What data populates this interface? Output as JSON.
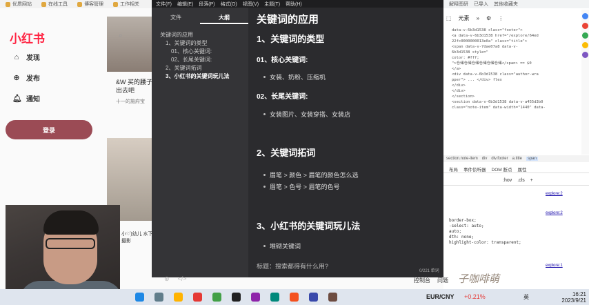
{
  "bookmarks": [
    "优质网站",
    "在线工具",
    "博客管理",
    "工作相关"
  ],
  "xhs": {
    "logo": "小红书",
    "nav": [
      {
        "label": "发现",
        "icon": "home-icon"
      },
      {
        "label": "发布",
        "icon": "plus-icon"
      },
      {
        "label": "通知",
        "icon": "bell-icon"
      }
    ],
    "login_label": "登录",
    "card_title": "&W 买的腰子 出去吧",
    "card_meta": "十一的施府宝",
    "card2": "小♡)幼儿 水下摄影"
  },
  "editor": {
    "menu": [
      "文件(F)",
      "编辑(E)",
      "段落(P)",
      "格式(O)",
      "视图(V)",
      "主题(T)",
      "帮助(H)"
    ],
    "tabs": {
      "file": "文件",
      "outline": "大纲"
    },
    "outline": [
      {
        "text": "关键词的应用",
        "level": 1
      },
      {
        "text": "1、关键词的类型",
        "level": 2
      },
      {
        "text": "01、核心关键词:",
        "level": 3
      },
      {
        "text": "02、长尾关键词:",
        "level": 3
      },
      {
        "text": "2、关键词拓词",
        "level": 2
      },
      {
        "text": "3、小红书的关键词玩儿法",
        "level": 2
      }
    ],
    "doc": {
      "title": "关键词的应用",
      "h2_1": "1、关键词的类型",
      "h3_1": "01、核心关键词:",
      "li_1": "女装、奶粉、压缩机",
      "h3_2": "02、长尾关键词:",
      "li_2": "女装图片、女装穿搭、女装店",
      "h2_2": "2、关键词拓词",
      "li_3": "眉笔 > 颜色 > 眉笔的颜色怎么选",
      "li_4": "眉笔 > 色号 > 眉笔的色号",
      "h2_3": "3、小红书的关键词玩儿法",
      "li_5": "堆砌关键词",
      "cut_line": "标题：搜索都得有什么用?"
    },
    "word_count": "0/221 单词"
  },
  "devtools": {
    "tabs": [
      "解释图研",
      "已导入",
      "其他收藏夹"
    ],
    "toolbar": [
      "元素",
      "»",
      "⚙",
      "⋮"
    ],
    "code_lines": [
      "data-v-6b3d1538 class=\"footer\">",
      "<a data-v-6b3d1538 href=\"/explore/64ed",
      "22fc0000000013e0a\" class=\"title\">",
      "<span data-v-7dae07a8 data-v-",
      "6b3d1538 style=\"",
      "color: #fff;",
      "\">仓储仓储仓储仓储仓储仓储</span> == $0",
      "</a>",
      "<div data-v-6b3d1538 class=\"author-wra",
      "pper\"> ... </div> flex",
      "</div>",
      "</div>",
      "</section>",
      "<section data-v-6b3d1538 data-v-a455d3b0",
      "class=\"note-item\" data-width=\"1440\" data-"
    ],
    "breadcrumb": [
      "section.note-item",
      "div",
      "div.footer",
      "a.title",
      "span"
    ],
    "subtabs": [
      "布局",
      "事件侦听器",
      "DOM 断点",
      "属性"
    ],
    "filter": [
      ":hov",
      ".cls",
      "+"
    ],
    "style_lines": [
      "border-box;",
      "-select: auto;",
      "auto;",
      "dth: none;",
      "highlight-color: transparent;"
    ],
    "links": [
      "explore:2",
      "explore:2",
      "explore:1"
    ],
    "bottom": [
      "控制台",
      "问题"
    ],
    "watermark": "子咖啡萌"
  },
  "taskbar": {
    "ticker": "EUR/CNY",
    "change": "+0.21%",
    "lang": "英",
    "time": "16:21",
    "date": "2023/9/21"
  }
}
